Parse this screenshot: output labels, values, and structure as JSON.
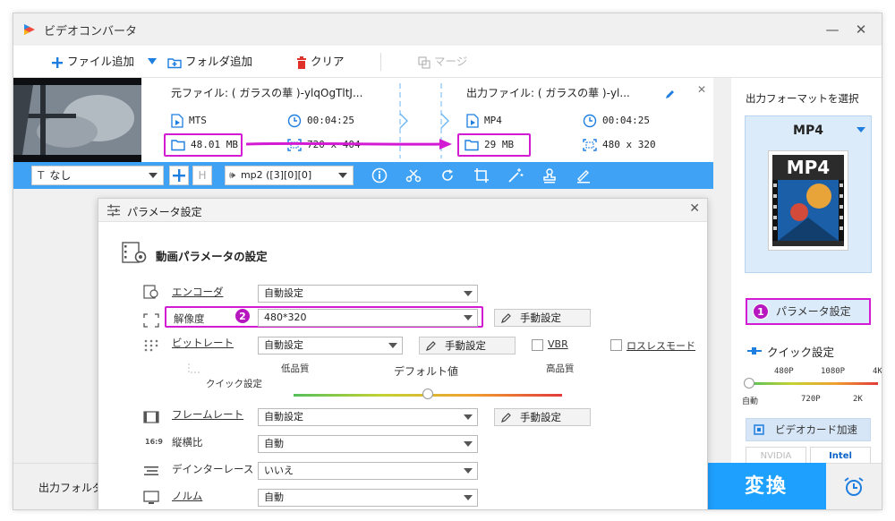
{
  "app": {
    "title": "ビデオコンバータ"
  },
  "window_controls": {
    "minimize": "—",
    "close": "✕"
  },
  "toolbar": {
    "add_file": "ファイル追加",
    "add_folder": "フォルダ追加",
    "clear": "クリア",
    "merge": "マージ"
  },
  "file": {
    "source_name": "元ファイル: ( ガラスの華 )-ylqOgTltJ...",
    "output_name": "出力ファイル: ( ガラスの華 )-yl...",
    "source": {
      "format": "MTS",
      "duration": "00:04:25",
      "size": "48.01 MB",
      "resolution": "720 x 404"
    },
    "output": {
      "format": "MP4",
      "duration": "00:04:25",
      "size": "29 MB",
      "resolution": "480 x 320"
    },
    "close": "✕"
  },
  "editbar": {
    "subtitle_value": "なし",
    "audio_value": "mp2 ([3][0][0]"
  },
  "right_panel": {
    "title": "出力フォーマットを選択",
    "format_name": "MP4",
    "format_thumb_text": "MP4",
    "param_button": "パラメータ設定",
    "param_badge": "1",
    "quick_title": "クイック設定",
    "quick_ticks_top": [
      "480P",
      "1080P",
      "4K"
    ],
    "quick_ticks_bottom": [
      "自動",
      "720P",
      "2K"
    ],
    "gpu_button": "ビデオカード加速",
    "vendors": [
      "NVIDIA",
      "Intel"
    ]
  },
  "bottom": {
    "output_folder_label": "出力フォルダ:",
    "convert_button": "変換"
  },
  "dialog": {
    "title": "パラメータ設定",
    "close": "✕",
    "section_title": "動画パラメータの設定",
    "rows": {
      "encoder": {
        "label": "エンコーダ",
        "value": "自動設定"
      },
      "resolution": {
        "label": "解像度",
        "value": "480*320",
        "badge": "2",
        "manual": "手動設定"
      },
      "bitrate": {
        "label": "ビットレート",
        "value": "自動設定",
        "manual": "手動設定",
        "vbr": "VBR",
        "lossless": "ロスレスモード"
      },
      "quick": {
        "label": "クイック設定",
        "low": "低品質",
        "default": "デフォルト値",
        "high": "高品質"
      },
      "framerate": {
        "label": "フレームレート",
        "value": "自動設定",
        "manual": "手動設定"
      },
      "aspect": {
        "label": "縦横比",
        "value": "自動"
      },
      "deinterlace": {
        "label": "デインターレース",
        "value": "いいえ"
      },
      "norm": {
        "label": "ノルム",
        "value": "自動"
      }
    }
  },
  "colors": {
    "accent": "#1ea0ff",
    "highlight": "#d21bd2",
    "editbar": "#3fa2f5"
  }
}
